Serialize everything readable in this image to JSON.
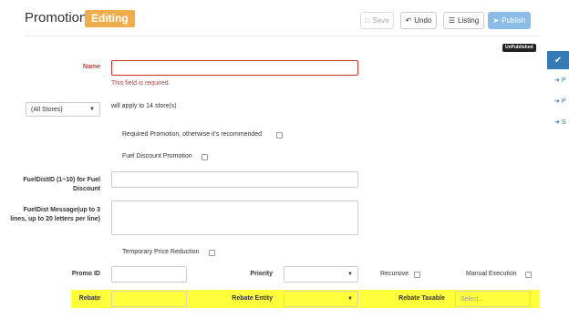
{
  "header": {
    "title": "Promotion",
    "status_badge": "Editing",
    "toolbar": {
      "save_label": "Save",
      "undo_label": "Undo",
      "listing_label": "Listing",
      "publish_label": "Publish"
    },
    "publication_badge": "UnPublished"
  },
  "sidebar": {
    "links": [
      "P",
      "P",
      "S"
    ]
  },
  "form": {
    "name": {
      "label": "Name",
      "value": "",
      "error": "This field is required."
    },
    "stores": {
      "selected": "(All Stores)",
      "note": "will apply to 14 store(s)"
    },
    "required_promotion": {
      "label": "Required Promotion, otherwise it's recommended",
      "checked": false
    },
    "fuel_discount_promotion": {
      "label": "Fuel Discount Promotion",
      "checked": false
    },
    "fuel_dist_id": {
      "label": "FuelDistID (1~10) for Fuel Discount",
      "value": ""
    },
    "fuel_dist_message": {
      "label": "FuelDist Message(up to 3 lines, up to 20 letters per line)",
      "value": ""
    },
    "temporary_price_reduction": {
      "label": "Temporary Price Reduction",
      "checked": false
    },
    "promo_id": {
      "label": "Promo ID",
      "value": ""
    },
    "priority": {
      "label": "Priority",
      "selected": ""
    },
    "recursive": {
      "label": "Recursive",
      "checked": false
    },
    "manual_execution": {
      "label": "Manual Execution",
      "checked": false
    },
    "rebate": {
      "label": "Rebate",
      "value": ""
    },
    "rebate_entity": {
      "label": "Rebate Entity",
      "selected": ""
    },
    "rebate_taxable": {
      "label": "Rebate Taxable",
      "placeholder": "Select..."
    }
  },
  "colors": {
    "editing_badge": "#f0ad4e",
    "publish_button": "#8bbce8",
    "highlight_row": "#ffff3c",
    "error": "#a94442",
    "side_accent": "#337ab7"
  },
  "icons": {
    "save": "floppy-icon",
    "undo": "undo-icon",
    "listing": "list-icon",
    "publish": "paper-plane-icon",
    "sidebar_check": "check-icon",
    "sidebar_link": "arrow-right-icon",
    "select_caret": "caret-down-icon"
  }
}
